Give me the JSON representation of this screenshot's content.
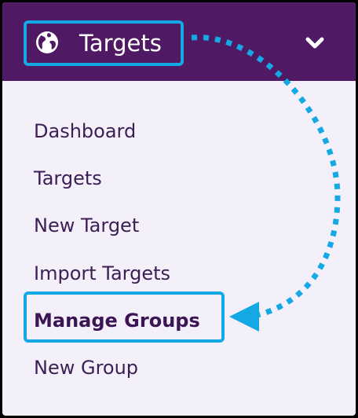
{
  "header": {
    "title": "Targets",
    "icon": "globe-icon",
    "toggle_icon": "chevron-down-icon",
    "background_color": "#4f1a63",
    "highlight_color": "#14a9e4"
  },
  "menu": {
    "items": [
      {
        "label": "Dashboard"
      },
      {
        "label": "Targets"
      },
      {
        "label": "New Target"
      },
      {
        "label": "Import Targets"
      },
      {
        "label": "Manage Groups",
        "active": true
      },
      {
        "label": "New Group"
      }
    ]
  },
  "annotation": {
    "arrow_icon": "dotted-arrow-icon",
    "color": "#14a9e4"
  }
}
